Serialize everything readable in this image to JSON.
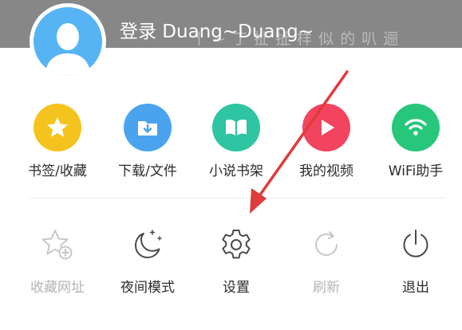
{
  "header": {
    "login_text": "登录 Duang~Duang~",
    "background_color": "#878787",
    "avatar_color": "#56b4f5"
  },
  "shortcuts": [
    {
      "label": "书签/收藏",
      "icon": "star-icon",
      "color": "#f5c31e"
    },
    {
      "label": "下载/文件",
      "icon": "download-folder-icon",
      "color": "#4aa3ef"
    },
    {
      "label": "小说书架",
      "icon": "book-icon",
      "color": "#2fc4a2"
    },
    {
      "label": "我的视频",
      "icon": "play-icon",
      "color": "#f2445f"
    },
    {
      "label": "WiFi助手",
      "icon": "wifi-icon",
      "color": "#26c77a"
    }
  ],
  "tools": [
    {
      "label": "收藏网址",
      "icon": "star-add-icon",
      "enabled": false
    },
    {
      "label": "夜间模式",
      "icon": "moon-icon",
      "enabled": true
    },
    {
      "label": "设置",
      "icon": "gear-icon",
      "enabled": true
    },
    {
      "label": "刷新",
      "icon": "refresh-icon",
      "enabled": false
    },
    {
      "label": "退出",
      "icon": "power-icon",
      "enabled": true
    }
  ],
  "annotation": {
    "arrow_color": "#e03a3a",
    "points_to": "settings"
  }
}
